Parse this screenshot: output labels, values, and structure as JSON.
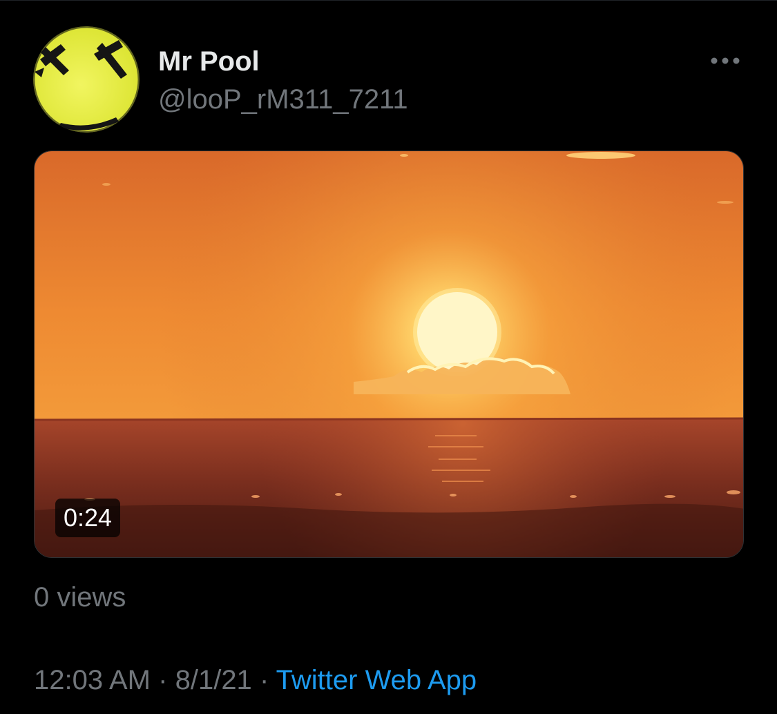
{
  "tweet": {
    "author": {
      "display_name": "Mr Pool",
      "handle": "@looP_rM311_7211",
      "avatar_icon": "yellow-x-eyes-face-icon"
    },
    "more_icon": "more-horizontal-icon",
    "media": {
      "type": "video",
      "duration": "0:24"
    },
    "views": "0 views",
    "time": "12:03 AM",
    "separator_1": "·",
    "date": "8/1/21",
    "separator_2": "·",
    "source": "Twitter Web App"
  },
  "colors": {
    "background": "#000000",
    "primary_text": "#e7e9ea",
    "secondary_text": "#71767b",
    "link": "#1d9bf0",
    "avatar_yellow": "#e6ef3a"
  }
}
